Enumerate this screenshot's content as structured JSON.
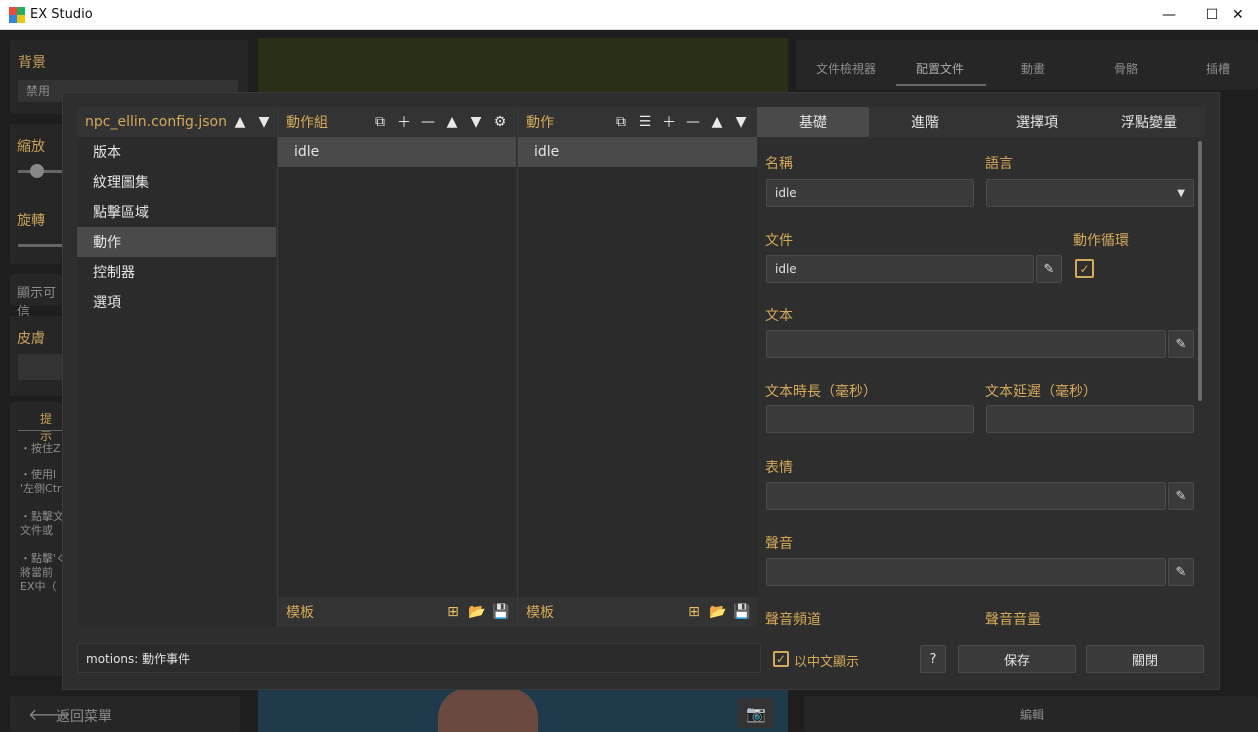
{
  "window": {
    "title": "EX Studio",
    "minimize": "—",
    "maximize": "☐",
    "close": "✕"
  },
  "background": {
    "left": {
      "bg_label": "背景",
      "bg_value": "禁用",
      "zoom_label": "縮放",
      "rotate_label": "旋轉",
      "visible_label": "顯示可信",
      "skin_label": "皮膚",
      "tips_title": "提示",
      "tips": [
        "・按住Z",
        "・使用l\n'左側Ctr",
        "・點擊文\n文件或",
        "・點擊'ぐ\n將當前\nEX中（"
      ],
      "back_label": "返回菜單"
    },
    "right_tabs": [
      "文件檢視器",
      "配置文件",
      "動畫",
      "骨骼",
      "插槽"
    ],
    "edit_label": "編輯"
  },
  "dialog": {
    "file": {
      "name": "npc_ellin.config.json",
      "items": [
        "版本",
        "紋理圖集",
        "點擊區域",
        "動作",
        "控制器",
        "選項"
      ],
      "selected": 3
    },
    "groups": {
      "title": "動作組",
      "items": [
        "idle"
      ],
      "template": "模板"
    },
    "motions": {
      "title": "動作",
      "items": [
        "idle"
      ],
      "template": "模板"
    },
    "tabs": [
      "基礎",
      "進階",
      "選擇項",
      "浮點變量"
    ],
    "active_tab": 0,
    "form": {
      "name_label": "名稱",
      "name_value": "idle",
      "lang_label": "語言",
      "lang_value": "",
      "file_label": "文件",
      "file_value": "idle",
      "loop_label": "動作循環",
      "loop_checked": true,
      "text_label": "文本",
      "text_value": "",
      "text_dur_label": "文本時長（毫秒）",
      "text_dur_value": "",
      "text_delay_label": "文本延遲（毫秒）",
      "text_delay_value": "",
      "expr_label": "表情",
      "expr_value": "",
      "sound_label": "聲音",
      "sound_value": "",
      "sound_ch_label": "聲音頻道",
      "sound_vol_label": "聲音音量"
    },
    "status": "motions: 動作事件",
    "chinese_label": "以中文顯示",
    "help_label": "?",
    "save_label": "保存",
    "close_label": "關閉"
  },
  "colors": {
    "accent": "#d5a95a"
  }
}
